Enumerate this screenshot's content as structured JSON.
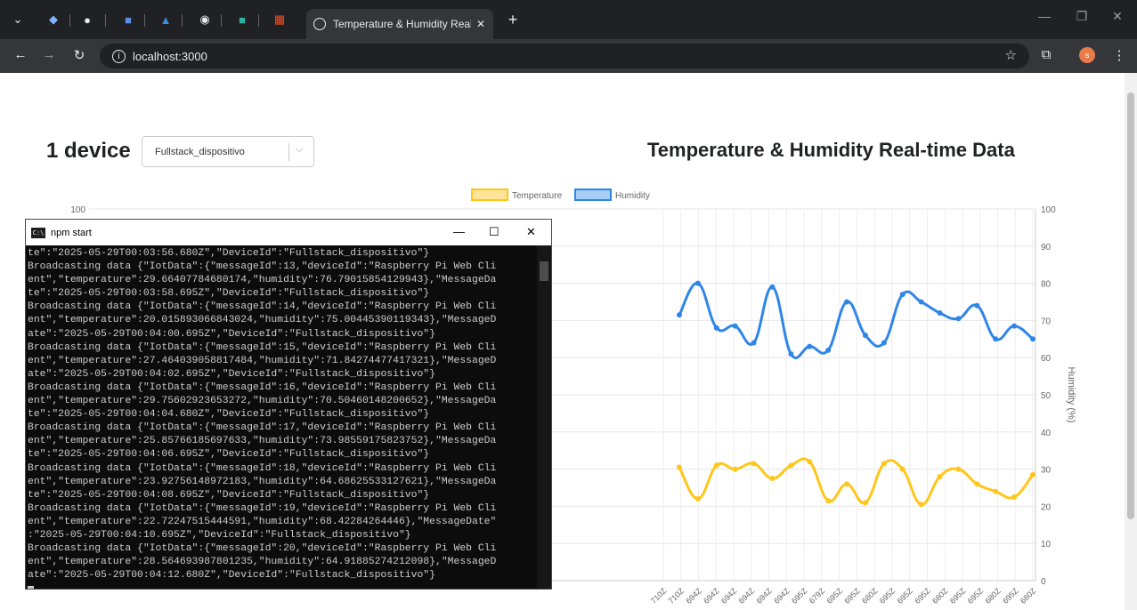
{
  "browser": {
    "tab_title": "Temperature & Humidity Real-t",
    "url": "localhost:3000",
    "avatar_initial": "s"
  },
  "page": {
    "device_count": "1 device",
    "device_selected": "Fullstack_dispositivo",
    "title": "Temperature & Humidity Real-time Data"
  },
  "terminal": {
    "title": "npm start",
    "lines": [
      "te\":\"2025-05-29T00:03:56.680Z\",\"DeviceId\":\"Fullstack_dispositivo\"}",
      "Broadcasting data {\"IotData\":{\"messageId\":13,\"deviceId\":\"Raspberry Pi Web Cli",
      "ent\",\"temperature\":29.66407784680174,\"humidity\":76.79015854129943},\"MessageDa",
      "te\":\"2025-05-29T00:03:58.695Z\",\"DeviceId\":\"Fullstack_dispositivo\"}",
      "Broadcasting data {\"IotData\":{\"messageId\":14,\"deviceId\":\"Raspberry Pi Web Cli",
      "ent\",\"temperature\":20.01589306684302​4,\"humidity\":75.00445390119343},\"MessageD",
      "ate\":\"2025-05-29T00:04:00.695Z\",\"DeviceId\":\"Fullstack_dispositivo\"}",
      "Broadcasting data {\"IotData\":{\"messageId\":15,\"deviceId\":\"Raspberry Pi Web Cli",
      "ent\",\"temperature\":27.464039058817484,\"humidity\":71.84274477417321},\"MessageD",
      "ate\":\"2025-05-29T00:04:02.695Z\",\"DeviceId\":\"Fullstack_dispositivo\"}",
      "Broadcasting data {\"IotData\":{\"messageId\":16,\"deviceId\":\"Raspberry Pi Web Cli",
      "ent\",\"temperature\":29.75602923653272,\"humidity\":70.50460148200652},\"MessageDa",
      "te\":\"2025-05-29T00:04:04.680Z\",\"DeviceId\":\"Fullstack_dispositivo\"}",
      "Broadcasting data {\"IotData\":{\"messageId\":17,\"deviceId\":\"Raspberry Pi Web Cli",
      "ent\",\"temperature\":25.85766185697633,\"humidity\":73.98559175823752},\"MessageDa",
      "te\":\"2025-05-29T00:04:06.695Z\",\"DeviceId\":\"Fullstack_dispositivo\"}",
      "Broadcasting data {\"IotData\":{\"messageId\":18,\"deviceId\":\"Raspberry Pi Web Cli",
      "ent\",\"temperature\":23.92756148972183,\"humidity\":64.68625533127621},\"MessageDa",
      "te\":\"2025-05-29T00:04:08.695Z\",\"DeviceId\":\"Fullstack_dispositivo\"}",
      "Broadcasting data {\"IotData\":{\"messageId\":19,\"deviceId\":\"Raspberry Pi Web Cli",
      "ent\",\"temperature\":22.72247515444591,\"humidity\":68.42284264446},\"MessageDate\"",
      ":\"2025-05-29T00:04:10.695Z\",\"DeviceId\":\"Fullstack_dispositivo\"}",
      "Broadcasting data {\"IotData\":{\"messageId\":20,\"deviceId\":\"Raspberry Pi Web Cli",
      "ent\",\"temperature\":28.564693987801235,\"humidity\":64.91885274212098},\"MessageD",
      "ate\":\"2025-05-29T00:04:12.680Z\",\"DeviceId\":\"Fullstack_dispositivo\"}"
    ]
  },
  "colors": {
    "temperature": "#ffc61a",
    "humidity": "#2f86e8",
    "browser_frame": "#202124",
    "terminal_bg": "#0c0c0c"
  },
  "chart_data": {
    "type": "line",
    "legend": [
      "Temperature",
      "Humidity"
    ],
    "legend_position": "top",
    "y_left_ticks_visible": [
      "100"
    ],
    "y_right_label": "Humidity (%)",
    "y_right_ticks": [
      "0",
      "10",
      "20",
      "30",
      "40",
      "50",
      "60",
      "70",
      "80",
      "90",
      "100"
    ],
    "ylim": [
      0,
      100
    ],
    "x_tick_labels": [
      "710Z",
      "710Z",
      "694Z",
      "694Z",
      "694Z",
      "694Z",
      "694Z",
      "694Z",
      "695Z",
      "679Z",
      "695Z",
      "695Z",
      "680Z",
      "695Z",
      "695Z",
      "695Z",
      "680Z",
      "695Z",
      "695Z",
      "680Z",
      "695Z",
      "680Z"
    ],
    "series": [
      {
        "name": "Temperature",
        "values": [
          30.5,
          22,
          31,
          30,
          31.5,
          27.5,
          31,
          32,
          21.5,
          26,
          21,
          31.5,
          30,
          20.5,
          28,
          30,
          26,
          24,
          22.5,
          28.5
        ]
      },
      {
        "name": "Humidity",
        "values": [
          71.5,
          80,
          68,
          68.5,
          64,
          79,
          61,
          63,
          62,
          75,
          66,
          64,
          77,
          75,
          72,
          70.5,
          74,
          65,
          68.5,
          65
        ]
      }
    ],
    "grid": true
  }
}
